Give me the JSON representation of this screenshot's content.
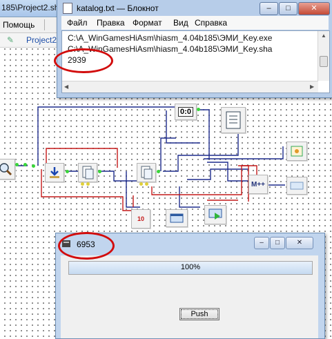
{
  "ide": {
    "title": "185\\Project2.sha",
    "menu_help": "Помощь",
    "tab_label": "Project2"
  },
  "notepad": {
    "title": "katalog.txt — Блокнот",
    "menu": [
      "Файл",
      "Правка",
      "Формат",
      "Вид",
      "Справка"
    ],
    "lines": [
      "C:\\A_WinGamesHiAsm\\hiasm_4.04b185\\ЭМИ_Key.exe",
      "C:\\A_WinGamesHiAsm\\hiasm_4.04b185\\ЭМИ_Key.sha",
      "2939"
    ],
    "buttons": {
      "minimize": "–",
      "maximize": "□",
      "close": "✕"
    }
  },
  "app_window": {
    "title": "6953",
    "progress": {
      "value": 100,
      "label": "100%"
    },
    "push_label": "Push",
    "buttons": {
      "minimize": "–",
      "maximize": "□",
      "close": "✕"
    }
  },
  "components": {
    "timer_label": "0:0",
    "convert_label": "10",
    "math_label": "M++"
  },
  "colors": {
    "annotation": "#d20c0c",
    "wire_blue": "#1c2a8c",
    "wire_red": "#c41818",
    "pin_green": "#39d63a"
  }
}
